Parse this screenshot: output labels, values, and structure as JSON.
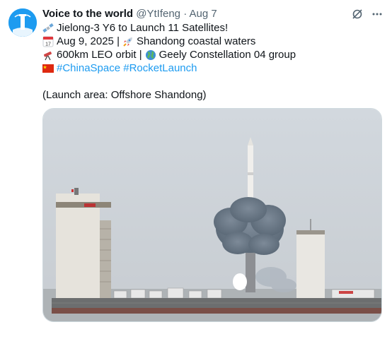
{
  "tweet": {
    "display_name": "Voice to the world",
    "handle": "@YtIfeng",
    "separator": "·",
    "date": "Aug 7",
    "lines": [
      {
        "icon": "satellite-icon",
        "text": "Jielong-3 Y6 to Launch 11 Satellites!"
      },
      {
        "icon": "calendar-icon",
        "text": "Aug 9, 2025 |",
        "icon2": "rocket-icon",
        "text2": "Shandong coastal waters"
      },
      {
        "icon": "telescope-icon",
        "text": "600km LEO orbit |",
        "icon2": "globe-icon",
        "text2": "Geely Constellation 04 group"
      },
      {
        "icon": "china-flag-icon",
        "hashtags": "#ChinaSpace #RocketLaunch"
      }
    ],
    "note": "(Launch area: Offshore Shandong)",
    "calendar_badge": "17"
  },
  "media": {
    "image_icon": "rocket-launch-photo",
    "colors": {
      "sky": "#d6dbe0",
      "sea": "#aeb3b5",
      "smoke": "#6f7d8c",
      "platform": "#6e5a55"
    }
  },
  "colors": {
    "accent": "#1d9bf0",
    "text": "#0f1419",
    "muted": "#536471"
  }
}
